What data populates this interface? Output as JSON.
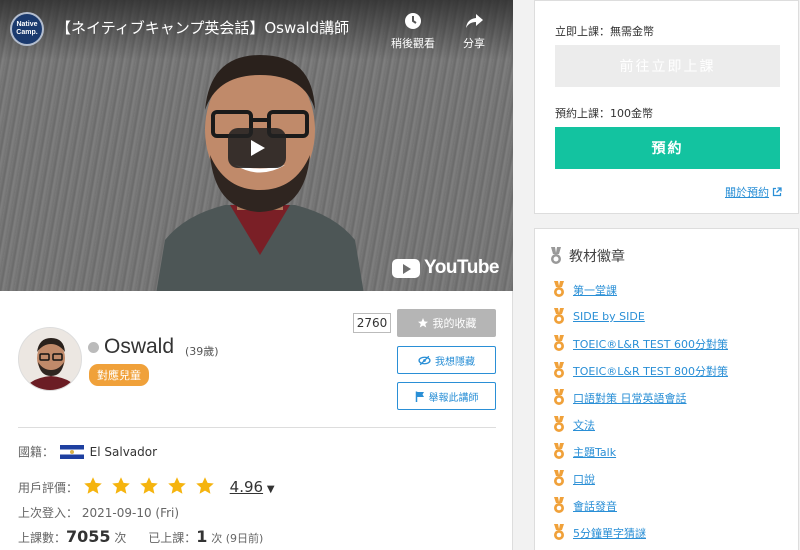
{
  "video": {
    "channel_logo": "Native Camp.",
    "title": "【ネイティブキャンプ英会話】Oswald講師",
    "watch_later_label": "稍後觀看",
    "share_label": "分享",
    "brand": "YouTube"
  },
  "profile": {
    "name": "Oswald",
    "age": "(39歲)",
    "kids_badge": "對應兒童",
    "favorite_count": "2760",
    "favorite_label": "我的收藏",
    "hide_label": "我想隱藏",
    "report_label": "舉報此講師",
    "nationality_label": "國籍：",
    "nationality": "El Salvador",
    "rating_label": "用戶評價：",
    "rating_value": "4.96",
    "rating_stars": 5,
    "last_login_label": "上次登入：",
    "last_login": "2021-09-10 (Fri)",
    "lessons_label": "上課數：",
    "lessons_count": "7055",
    "lessons_unit": "次",
    "taken_label": "已上課：",
    "taken_count": "1",
    "taken_unit": "次 (9日前)"
  },
  "booking": {
    "instant_label": "立即上課：無需金幣",
    "instant_button": "前往立即上課",
    "reserve_label": "預約上課：100金幣",
    "reserve_button": "預約",
    "about_link": "關於預約"
  },
  "badges": {
    "title": "教材徽章",
    "items": [
      "第一堂課",
      "SIDE by SIDE",
      "TOEIC®L&R TEST 600分對策",
      "TOEIC®L&R TEST 800分對策",
      "口語對策 日常英語會話",
      "文法",
      "主題Talk",
      "口說",
      "會話發音",
      "5分鐘單字猜謎"
    ]
  },
  "colors": {
    "accent_green": "#13c3a0",
    "link_blue": "#2a8fd6",
    "badge_orange": "#f0a13a",
    "star_yellow": "#f5b40f"
  }
}
